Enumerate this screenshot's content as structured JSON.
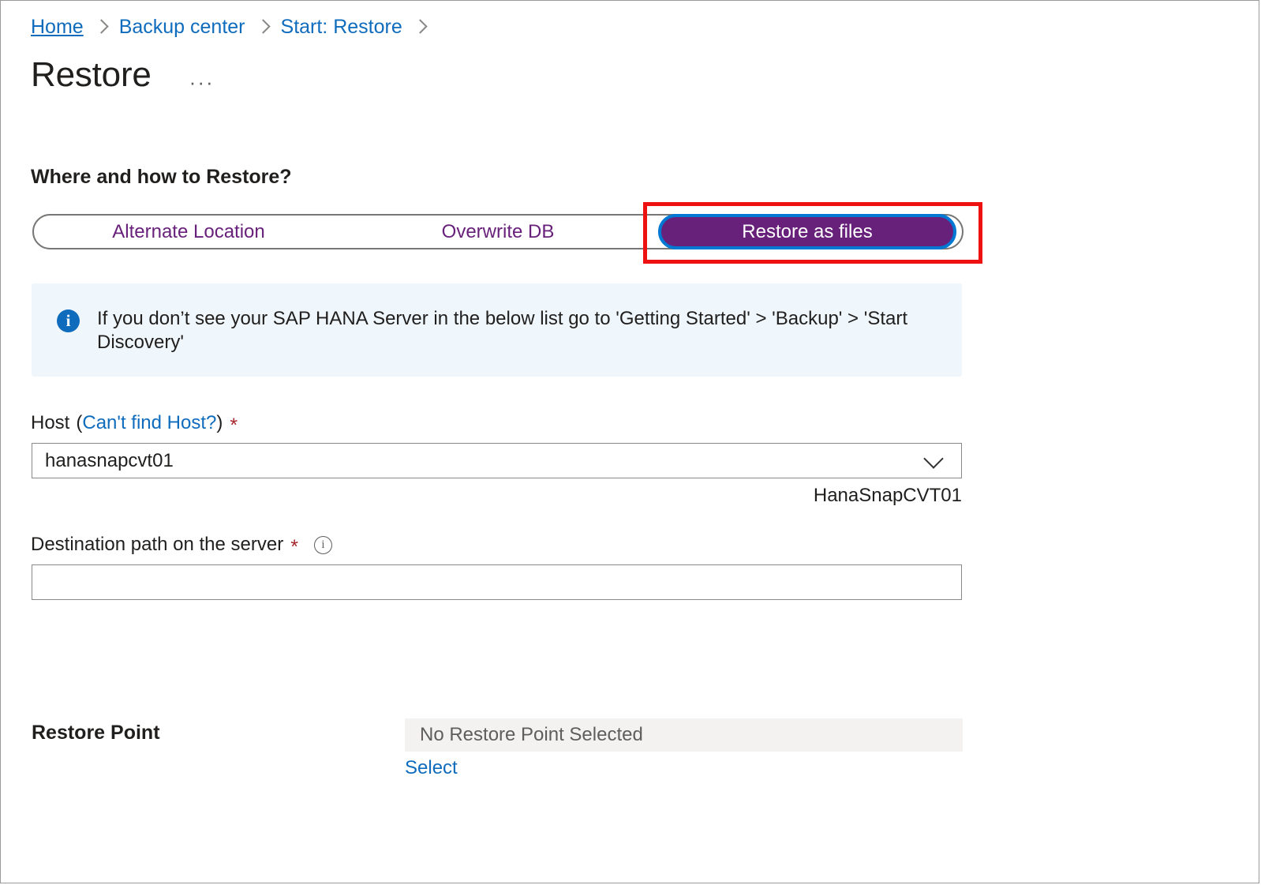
{
  "breadcrumb": {
    "home": "Home",
    "items": [
      "Backup center",
      "Start: Restore"
    ]
  },
  "header": {
    "title": "Restore",
    "ellipsis": "···"
  },
  "section": {
    "heading": "Where and how to Restore?"
  },
  "tabs": [
    {
      "label": "Alternate Location",
      "selected": false
    },
    {
      "label": "Overwrite DB",
      "selected": false
    },
    {
      "label": "Restore as files",
      "selected": true
    }
  ],
  "info_banner": {
    "icon": "info-icon",
    "text": "If you don’t see your SAP HANA Server in the below list go to 'Getting Started' > 'Backup' > 'Start Discovery'"
  },
  "host_field": {
    "label": "Host",
    "paren_open": "(",
    "link": "Can't find Host?",
    "paren_close": ")",
    "required": "*",
    "value": "hanasnapcvt01",
    "sublabel": "HanaSnapCVT01"
  },
  "destination_field": {
    "label": "Destination path on the server",
    "required": "*",
    "info_icon": "i",
    "value": "",
    "placeholder": ""
  },
  "restore_point": {
    "label": "Restore Point",
    "status": "No Restore Point Selected",
    "select_link": "Select"
  },
  "colors": {
    "accent_purple": "#68217a",
    "link_blue": "#0f6cbd",
    "focus_blue": "#0078d4",
    "annotation_red": "#ee1111",
    "required_red": "#a4262c",
    "info_bg": "#eff6fc",
    "readonly_bg": "#f3f2f1"
  }
}
